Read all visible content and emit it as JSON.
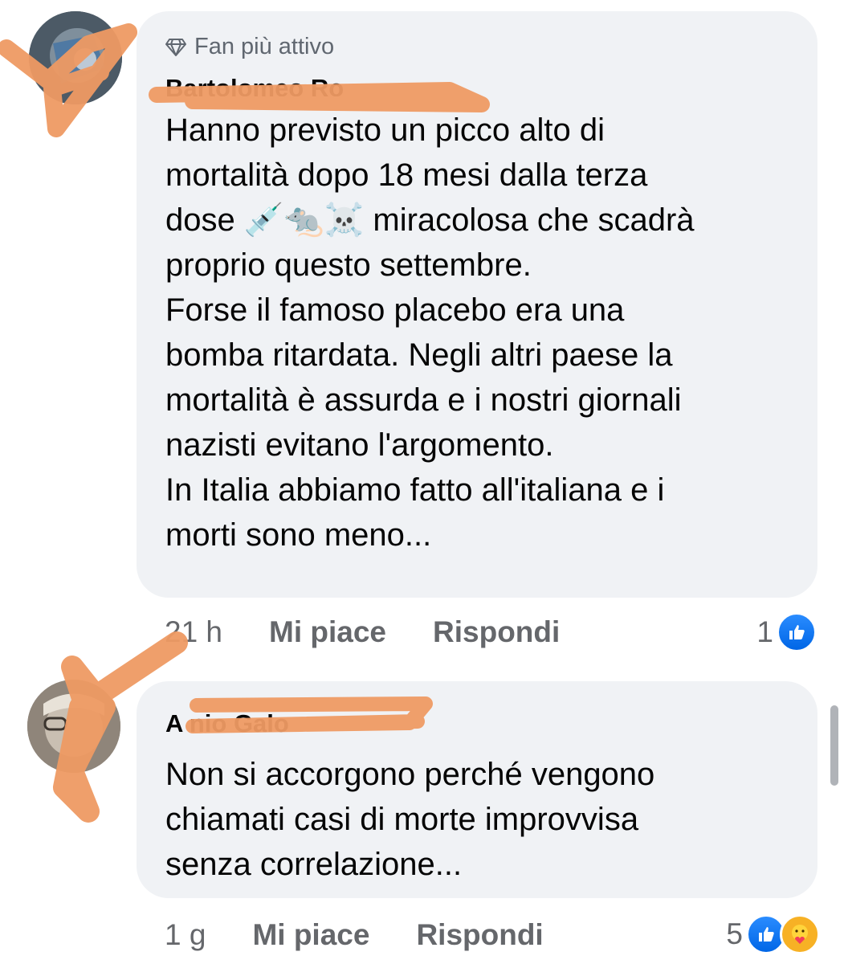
{
  "comments": [
    {
      "badge": "Fan più attivo",
      "author": "Bartolomeo Ro",
      "text_lines": [
        "Hanno previsto un picco alto di",
        "mortalità dopo 18 mesi dalla terza",
        "dose 💉🐀☠️ miracolosa che scadrà",
        "proprio questo settembre.",
        "Forse il famoso placebo era una",
        "bomba ritardata. Negli altri paese la",
        "mortalità è assurda e i nostri giornali",
        "nazisti evitano l'argomento.",
        "In Italia abbiamo fatto all'italiana e i",
        "morti sono meno..."
      ],
      "time": "21 h",
      "like_label": "Mi piace",
      "reply_label": "Rispondi",
      "reaction_count": "1",
      "reactions": [
        "like-icon"
      ]
    },
    {
      "author": "A    nio Galo",
      "text_lines": [
        "Non si accorgono perché vengono",
        "chiamati casi di morte improvvisa",
        "senza correlazione..."
      ],
      "time": "1 g",
      "like_label": "Mi piace",
      "reply_label": "Rispondi",
      "reaction_count": "5",
      "reactions": [
        "like-icon",
        "care-icon"
      ]
    }
  ],
  "colors": {
    "bubble": "#f0f2f5",
    "meta_text": "#65676b",
    "like_blue": "#1877f2",
    "redaction_scribble": "#f0a36b"
  }
}
